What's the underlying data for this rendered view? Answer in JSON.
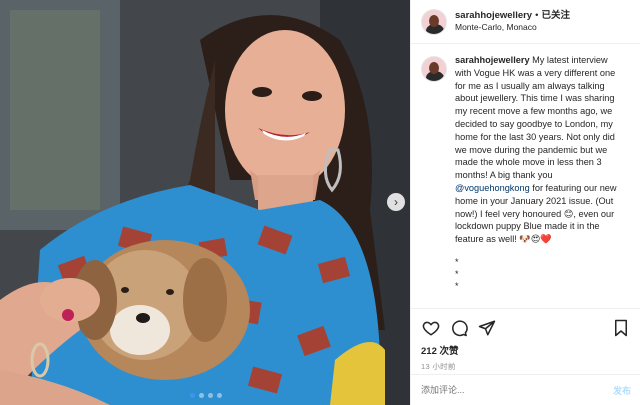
{
  "post": {
    "username": "sarahhojewellery",
    "separator": "•",
    "follow_label": "已关注",
    "location": "Monte-Carlo, Monaco",
    "caption_username": "sarahhojewellery",
    "caption_part1": " My latest interview with Vogue HK was a very different one for me as I usually am always talking about jewellery. This time I was sharing my recent move a few months ago, we decided to say goodbye to London, my home for the last 30 years. Not only did we move during the pandemic but we made the whole move in less then 3 months! A big thank you ",
    "caption_mention": "@voguehongkong",
    "caption_part2": " for featuring our new home in your January 2021 issue. (Out now!) I feel very honoured 😊, even our lockdown puppy Blue made it in the feature as well! 🐶😍❤️",
    "bullets": [
      "*",
      "*",
      "*"
    ],
    "likes": "212 次赞",
    "time": "13 小时前",
    "comment_placeholder": "添加评论...",
    "post_button": "发布"
  },
  "carousel": {
    "next_icon": "chevron-right-icon",
    "slide_count": 4,
    "active_slide": 1
  },
  "icons": {
    "like": "heart-icon",
    "comment": "comment-icon",
    "share": "share-icon",
    "save": "bookmark-icon"
  },
  "colors": {
    "link": "#00376b",
    "post_button": "#b2dffc",
    "muted": "#8e8e8e"
  }
}
